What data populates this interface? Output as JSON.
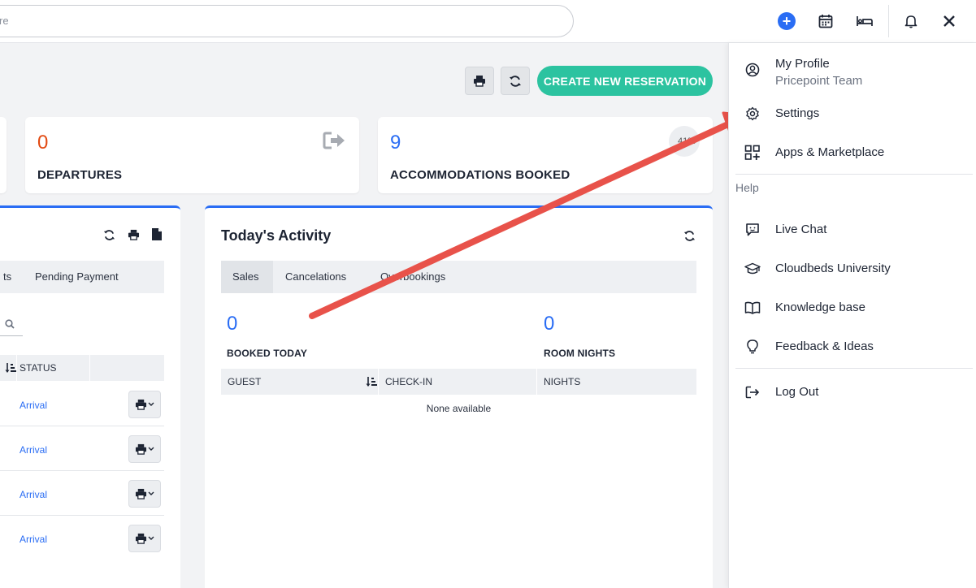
{
  "colors": {
    "accent": "#2a6df4",
    "create_button": "#2cc3a0",
    "departures_number": "#e24a12",
    "annotation_arrow": "#e8524a"
  },
  "topbar": {
    "search_text": "re",
    "icons": [
      "plus-circle-icon",
      "calendar-icon",
      "bed-icon",
      "bell-icon",
      "close-icon"
    ]
  },
  "actions": {
    "create_label": "CREATE NEW RESERVATION"
  },
  "stats": {
    "departures": {
      "value": "0",
      "label": "DEPARTURES"
    },
    "accommodations": {
      "value": "9",
      "label": "ACCOMMODATIONS BOOKED",
      "percent": "41%"
    }
  },
  "left_panel": {
    "tabs": [
      "ts",
      "Pending Payment"
    ],
    "status_header": "STATUS",
    "rows": [
      {
        "status": "Arrival"
      },
      {
        "status": "Arrival"
      },
      {
        "status": "Arrival"
      },
      {
        "status": "Arrival"
      }
    ]
  },
  "activity": {
    "title": "Today's Activity",
    "tabs": [
      "Sales",
      "Cancelations",
      "Overbookings"
    ],
    "active_tab": "Sales",
    "booked_today": {
      "value": "0",
      "label": "BOOKED TODAY"
    },
    "room_nights": {
      "value": "0",
      "label": "ROOM NIGHTS"
    },
    "columns": [
      "GUEST",
      "CHECK-IN",
      "NIGHTS"
    ],
    "empty_text": "None available"
  },
  "menu": {
    "profile": {
      "label": "My Profile",
      "team": "Pricepoint Team"
    },
    "settings": "Settings",
    "apps": "Apps & Marketplace",
    "help_heading": "Help",
    "live_chat": "Live Chat",
    "university": "Cloudbeds University",
    "knowledge": "Knowledge base",
    "feedback": "Feedback & Ideas",
    "logout": "Log Out"
  }
}
